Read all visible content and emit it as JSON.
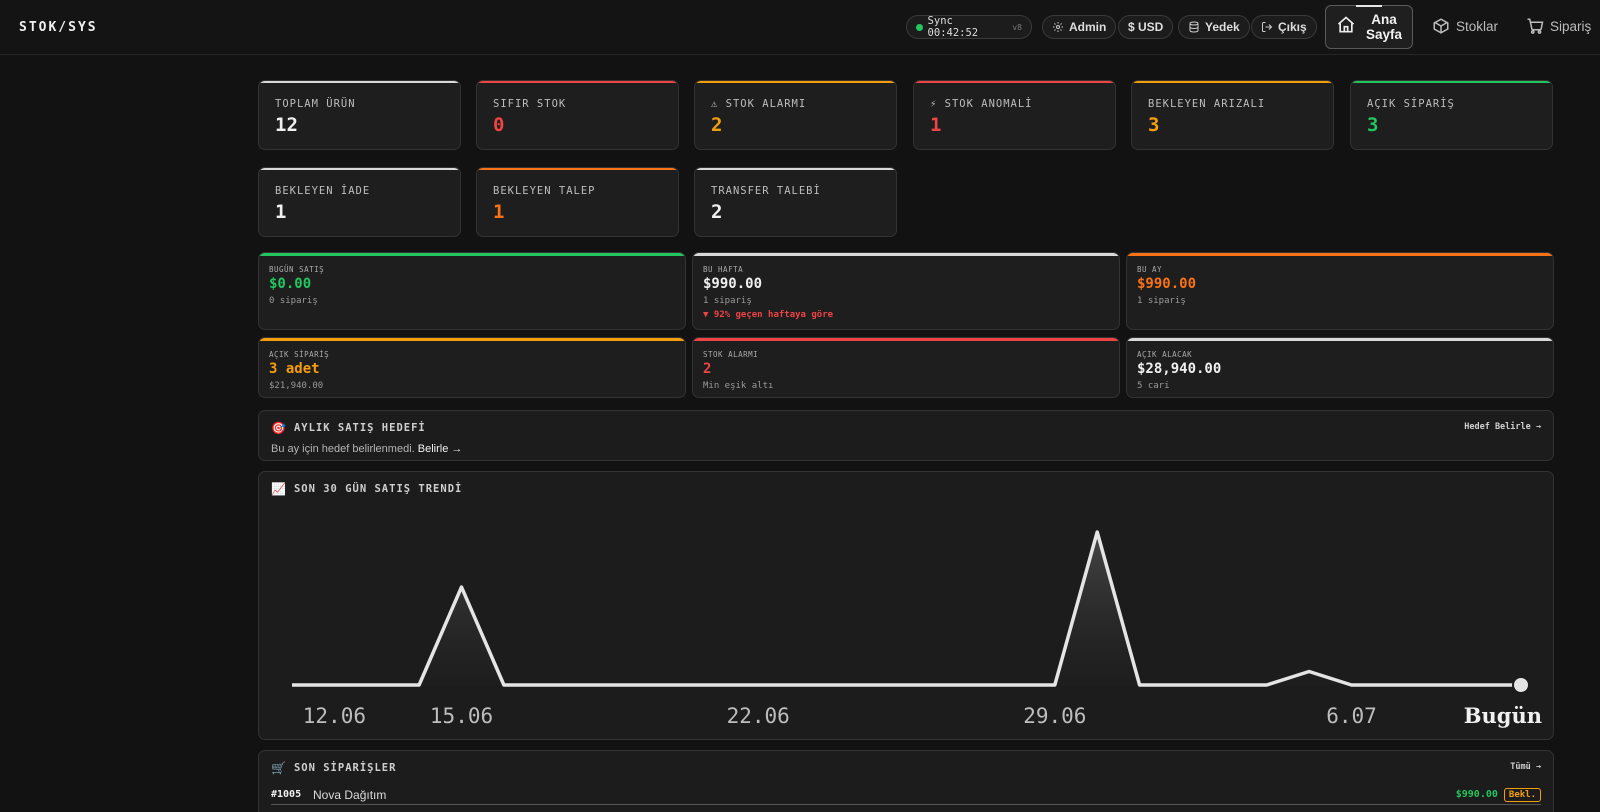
{
  "app": {
    "logo": "STOK/SYS"
  },
  "topbar": {
    "sync_label": "Sync 00:42:52",
    "sync_version": "v8",
    "admin_label": "Admin",
    "currency_label": "$ USD",
    "backup_label": "Yedek",
    "logout_label": "Çıkış",
    "nav": [
      {
        "label": "Ana Sayfa",
        "icon": "home-icon",
        "active": true
      },
      {
        "label": "Stoklar",
        "icon": "box-icon"
      },
      {
        "label": "Sipariş",
        "icon": "cart-icon"
      }
    ]
  },
  "stats": [
    {
      "label": "TOPLAM ÜRÜN",
      "value": "12",
      "color": "#f0f0f0",
      "bar": "#d9d9d9"
    },
    {
      "label": "SIFIR STOK",
      "value": "0",
      "color": "#ef4444",
      "bar": "#ef4444"
    },
    {
      "label": "⚠ STOK ALARMI",
      "value": "2",
      "color": "#f59e0b",
      "bar": "#f59e0b"
    },
    {
      "label": "⚡ STOK ANOMALİ",
      "value": "1",
      "color": "#ef4444",
      "bar": "#ef4444"
    },
    {
      "label": "BEKLEYEN ARIZALI",
      "value": "3",
      "color": "#f59e0b",
      "bar": "#f59e0b"
    },
    {
      "label": "AÇIK SİPARİŞ",
      "value": "3",
      "color": "#22c55e",
      "bar": "#22c55e"
    },
    {
      "label": "BEKLEYEN İADE",
      "value": "1",
      "color": "#f0f0f0",
      "bar": "#d9d9d9"
    },
    {
      "label": "BEKLEYEN TALEP",
      "value": "1",
      "color": "#f97316",
      "bar": "#f97316"
    },
    {
      "label": "TRANSFER TALEBİ",
      "value": "2",
      "color": "#f0f0f0",
      "bar": "#d9d9d9"
    }
  ],
  "summary": [
    {
      "label": "BUGÜN SATIŞ",
      "value": "$0.00",
      "sub": "0 sipariş",
      "delta": "",
      "color": "#22c55e",
      "bar": "#22c55e"
    },
    {
      "label": "BU HAFTA",
      "value": "$990.00",
      "sub": "1 sipariş",
      "delta": "▼ 92% geçen haftaya göre",
      "color": "#f0f0f0",
      "bar": "#d9d9d9"
    },
    {
      "label": "BU AY",
      "value": "$990.00",
      "sub": "1 sipariş",
      "delta": "",
      "color": "#f97316",
      "bar": "#f97316"
    },
    {
      "label": "AÇIK SİPARİŞ",
      "value": "3 adet",
      "sub": "$21,940.00",
      "color": "#f59e0b",
      "bar": "#f59e0b"
    },
    {
      "label": "STOK ALARMI",
      "value": "2",
      "sub": "Min eşik altı",
      "color": "#ef4444",
      "bar": "#ef4444"
    },
    {
      "label": "AÇIK ALACAK",
      "value": "$28,940.00",
      "sub": "5 cari",
      "color": "#f0f0f0",
      "bar": "#d9d9d9"
    }
  ],
  "goal": {
    "emoji": "🎯",
    "title": "AYLIK SATIŞ HEDEFİ",
    "action": "Hedef Belirle →",
    "text": "Bu ay için hedef belirlenmedi.",
    "link": "Belirle →"
  },
  "trend": {
    "emoji": "📈",
    "title": "SON 30 GÜN SATIŞ TRENDİ"
  },
  "chart_data": {
    "type": "area",
    "x": [
      "11.06",
      "12.06",
      "13.06",
      "14.06",
      "15.06",
      "16.06",
      "17.06",
      "18.06",
      "19.06",
      "20.06",
      "21.06",
      "22.06",
      "23.06",
      "24.06",
      "25.06",
      "26.06",
      "27.06",
      "28.06",
      "29.06",
      "30.06",
      "1.07",
      "2.07",
      "3.07",
      "4.07",
      "5.07",
      "6.07",
      "7.07",
      "8.07",
      "9.07",
      "10.07"
    ],
    "values": [
      0,
      0,
      0,
      0,
      1600,
      0,
      0,
      0,
      0,
      0,
      0,
      0,
      0,
      0,
      0,
      0,
      0,
      0,
      0,
      2500,
      0,
      0,
      0,
      0,
      220,
      0,
      0,
      0,
      0,
      0
    ],
    "tick_labels": [
      "12.06",
      "15.06",
      "22.06",
      "29.06",
      "6.07",
      "Bugün"
    ],
    "grid": false,
    "legend": "none"
  },
  "orders": {
    "emoji": "🛒",
    "title": "SON SİPARİŞLER",
    "action": "Tümü →",
    "rows": [
      {
        "id": "#1005",
        "name": "Nova Dağıtım",
        "amount": "$990.00",
        "status": "Bekl."
      }
    ]
  }
}
